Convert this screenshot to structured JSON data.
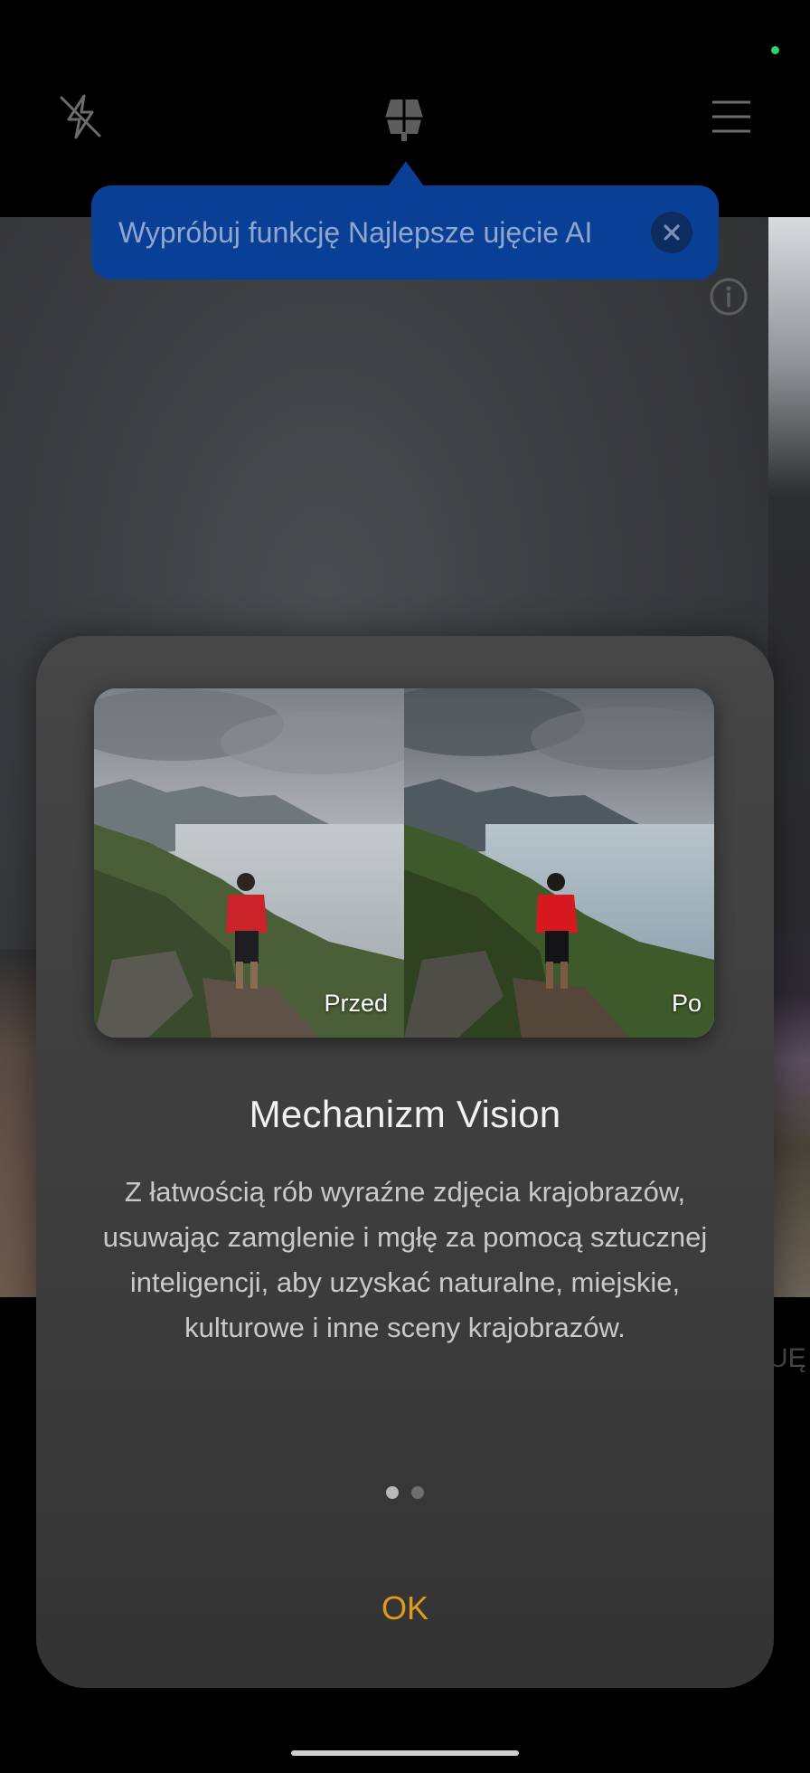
{
  "tooltip": {
    "text": "Wypróbuj funkcję Najlepsze ujęcie AI"
  },
  "dialog": {
    "before_label": "Przed",
    "after_label": "Po",
    "title": "Mechanizm Vision",
    "body": "Z łatwością rób wyraźne zdjęcia krajobrazów, usuwając zamglenie i mgłę za pomocą sztucznej inteligencji, aby uzyskać naturalne, miejskie, kulturowe i inne sceny krajobrazów.",
    "page_indicator": {
      "current": 1,
      "total": 2
    },
    "ok_label": "OK"
  },
  "background": {
    "partial_label": "UĘ"
  },
  "colors": {
    "tooltip_bg": "#0a3f96",
    "ok_accent": "#e09a1a",
    "status_dot": "#29d36b"
  }
}
